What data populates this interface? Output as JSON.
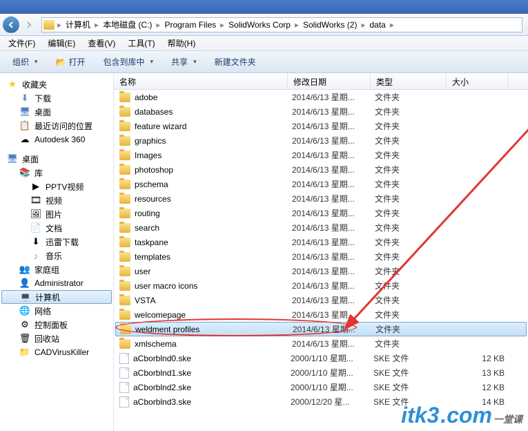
{
  "breadcrumb": [
    {
      "label": "计算机"
    },
    {
      "label": "本地磁盘 (C:)"
    },
    {
      "label": "Program Files"
    },
    {
      "label": "SolidWorks Corp"
    },
    {
      "label": "SolidWorks (2)"
    },
    {
      "label": "data"
    }
  ],
  "menubar": [
    {
      "label": "文件(F)"
    },
    {
      "label": "编辑(E)"
    },
    {
      "label": "查看(V)"
    },
    {
      "label": "工具(T)"
    },
    {
      "label": "帮助(H)"
    }
  ],
  "toolbar": {
    "organize": "组织",
    "open": "打开",
    "include": "包含到库中",
    "share": "共享",
    "newfolder": "新建文件夹"
  },
  "columns": {
    "name": "名称",
    "date": "修改日期",
    "type": "类型",
    "size": "大小"
  },
  "sidebar": {
    "favorites": "收藏夹",
    "downloads": "下载",
    "desktop": "桌面",
    "recent": "最近访问的位置",
    "autodesk": "Autodesk 360",
    "desktop2": "桌面",
    "libraries": "库",
    "pptv": "PPTV视频",
    "videos": "视频",
    "pictures": "图片",
    "documents": "文档",
    "xunlei": "迅雷下载",
    "music": "音乐",
    "homegroup": "家庭组",
    "admin": "Administrator",
    "computer": "计算机",
    "network": "网络",
    "controlpanel": "控制面板",
    "recycle": "回收站",
    "cadvirus": "CADVirusKiller"
  },
  "files": [
    {
      "name": "adobe",
      "date": "2014/6/13 星期...",
      "type": "文件夹",
      "size": "",
      "kind": "folder"
    },
    {
      "name": "databases",
      "date": "2014/6/13 星期...",
      "type": "文件夹",
      "size": "",
      "kind": "folder"
    },
    {
      "name": "feature wizard",
      "date": "2014/6/13 星期...",
      "type": "文件夹",
      "size": "",
      "kind": "folder"
    },
    {
      "name": "graphics",
      "date": "2014/6/13 星期...",
      "type": "文件夹",
      "size": "",
      "kind": "folder"
    },
    {
      "name": "Images",
      "date": "2014/6/13 星期...",
      "type": "文件夹",
      "size": "",
      "kind": "folder"
    },
    {
      "name": "photoshop",
      "date": "2014/6/13 星期...",
      "type": "文件夹",
      "size": "",
      "kind": "folder"
    },
    {
      "name": "pschema",
      "date": "2014/6/13 星期...",
      "type": "文件夹",
      "size": "",
      "kind": "folder"
    },
    {
      "name": "resources",
      "date": "2014/6/13 星期...",
      "type": "文件夹",
      "size": "",
      "kind": "folder"
    },
    {
      "name": "routing",
      "date": "2014/6/13 星期...",
      "type": "文件夹",
      "size": "",
      "kind": "folder"
    },
    {
      "name": "search",
      "date": "2014/6/13 星期...",
      "type": "文件夹",
      "size": "",
      "kind": "folder"
    },
    {
      "name": "taskpane",
      "date": "2014/6/13 星期...",
      "type": "文件夹",
      "size": "",
      "kind": "folder"
    },
    {
      "name": "templates",
      "date": "2014/6/13 星期...",
      "type": "文件夹",
      "size": "",
      "kind": "folder"
    },
    {
      "name": "user",
      "date": "2014/6/13 星期...",
      "type": "文件夹",
      "size": "",
      "kind": "folder"
    },
    {
      "name": "user macro icons",
      "date": "2014/6/13 星期...",
      "type": "文件夹",
      "size": "",
      "kind": "folder"
    },
    {
      "name": "VSTA",
      "date": "2014/6/13 星期...",
      "type": "文件夹",
      "size": "",
      "kind": "folder"
    },
    {
      "name": "welcomepage",
      "date": "2014/6/13 星期...",
      "type": "文件夹",
      "size": "",
      "kind": "folder"
    },
    {
      "name": "weldment profiles",
      "date": "2014/6/13 星期...",
      "type": "文件夹",
      "size": "",
      "kind": "folder",
      "selected": true
    },
    {
      "name": "xmlschema",
      "date": "2014/6/13 星期...",
      "type": "文件夹",
      "size": "",
      "kind": "folder"
    },
    {
      "name": "aCborblnd0.ske",
      "date": "2000/1/10 星期...",
      "type": "SKE 文件",
      "size": "12 KB",
      "kind": "file"
    },
    {
      "name": "aCborblnd1.ske",
      "date": "2000/1/10 星期...",
      "type": "SKE 文件",
      "size": "13 KB",
      "kind": "file"
    },
    {
      "name": "aCborblnd2.ske",
      "date": "2000/1/10 星期...",
      "type": "SKE 文件",
      "size": "12 KB",
      "kind": "file"
    },
    {
      "name": "aCborblnd3.ske",
      "date": "2000/12/20 星...",
      "type": "SKE 文件",
      "size": "14 KB",
      "kind": "file"
    }
  ],
  "watermark": {
    "brand": "itk3",
    "dom": ".com",
    "cn": "一堂课"
  }
}
